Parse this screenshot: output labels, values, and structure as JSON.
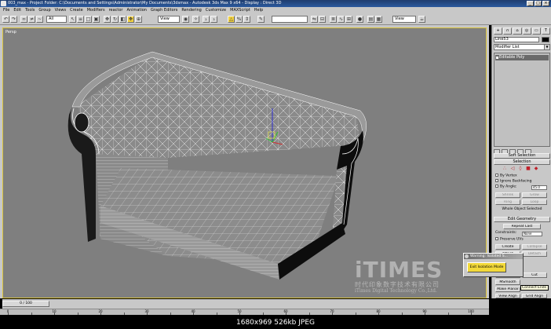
{
  "titlebar": {
    "title": "003_max  -  Project Folder: C:\\Documents and Settings\\Administrator\\My Documents\\3dsmax  -  Autodesk 3ds Max 9 x64  -  Display : Direct 3D",
    "buttons": [
      "_",
      "□",
      "×"
    ]
  },
  "menubar": {
    "items": [
      "File",
      "Edit",
      "Tools",
      "Group",
      "Views",
      "Create",
      "Modifiers",
      "reactor",
      "Animation",
      "Graph Editors",
      "Rendering",
      "Customize",
      "MAXScript",
      "Help"
    ]
  },
  "toolbar": {
    "selection_filter": "All",
    "ref_coord": "View",
    "named_selection": "",
    "view_combo": "View"
  },
  "viewport": {
    "label": "Persp",
    "border_color": "#d8c23a",
    "background": "#7f7f7f"
  },
  "command_panel": {
    "tabs": [
      "+",
      "∩",
      "⌂",
      "◎",
      "▭",
      "T"
    ],
    "object_name": "Line53",
    "modifier_list": "Modifier List",
    "stack_item": "Editable Poly",
    "rollouts": {
      "soft_selection": "Soft Selection",
      "selection": "Selection",
      "edit_geometry": "Edit Geometry"
    },
    "selection": {
      "by_vertex": "By Vertex",
      "ignore_backfacing": "Ignore Backfacing",
      "by_angle": "By Angle:",
      "by_angle_value": "45.0",
      "shrink": "Shrink",
      "grow": "Grow",
      "ring": "Ring",
      "loop": "Loop",
      "status": "Whole Object Selected"
    },
    "edit_geometry": {
      "repeat_last": "Repeat Last",
      "constraints_label": "Constraints:",
      "constraints_value": "None",
      "preserve_uvs": "Preserve UVs",
      "create": "Create",
      "collapse": "Collapse",
      "attach": "Attach",
      "detach": "Detach",
      "slice_plane": "Slice Plane",
      "quickslice": "QuickSlice",
      "cut": "Cut",
      "msmooth": "MSmooth",
      "make_planar": "Make Planar",
      "view_align": "View Align",
      "grid_align": "Grid Align",
      "relax": "Relax"
    }
  },
  "dialog": {
    "title": "Warning: Isolated S...",
    "button": "Exit Isolation Mode"
  },
  "tooltip": "Connect Ends",
  "watermark": {
    "brand": "iTIMES",
    "chinese": "时代印象数字技术有限公司",
    "english": "iTimes Digital Technology Co.,Ltd."
  },
  "timeline": {
    "slider": "0 / 100",
    "ticks": [
      "0",
      "10",
      "20",
      "30",
      "40",
      "50",
      "60",
      "70",
      "80",
      "90",
      "100"
    ]
  },
  "caption": "1680x969  526kb  JPEG"
}
